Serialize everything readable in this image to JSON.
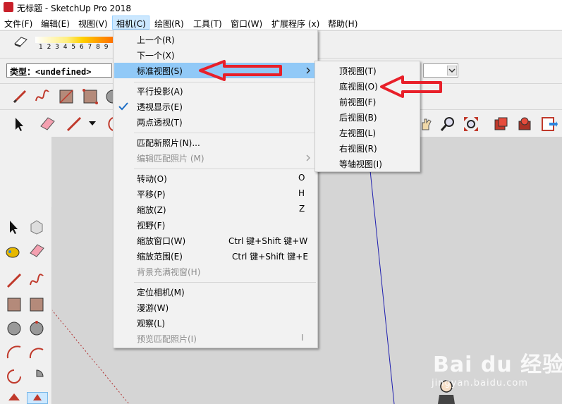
{
  "window": {
    "title": "无标题 - SketchUp Pro 2018"
  },
  "menubar": {
    "items": [
      "文件(F)",
      "编辑(E)",
      "视图(V)",
      "相机(C)",
      "绘图(R)",
      "工具(T)",
      "窗口(W)",
      "扩展程序 (x)",
      "帮助(H)"
    ],
    "active": "相机(C)"
  },
  "toolbar": {
    "shadow_scale": "1 2 3 4 5 6 7 8 9",
    "type_label": "类型：<undefined>"
  },
  "camera_menu": {
    "items": [
      {
        "label": "上一个(R)",
        "shortcut": "",
        "disabled": false
      },
      {
        "label": "下一个(X)",
        "shortcut": "",
        "disabled": false
      },
      {
        "label": "标准视图(S)",
        "shortcut": "",
        "disabled": false,
        "submenu": true,
        "highlighted": true
      },
      {
        "label": "平行投影(A)",
        "shortcut": "",
        "disabled": false
      },
      {
        "label": "透视显示(E)",
        "shortcut": "",
        "disabled": false,
        "checked": true
      },
      {
        "label": "两点透视(T)",
        "shortcut": "",
        "disabled": false
      },
      {
        "label": "匹配新照片(N)...",
        "shortcut": "",
        "disabled": false
      },
      {
        "label": "编辑匹配照片 (M)",
        "shortcut": "",
        "disabled": true,
        "submenu": true
      },
      {
        "label": "转动(O)",
        "shortcut": "O",
        "disabled": false
      },
      {
        "label": "平移(P)",
        "shortcut": "H",
        "disabled": false
      },
      {
        "label": "缩放(Z)",
        "shortcut": "Z",
        "disabled": false
      },
      {
        "label": "视野(F)",
        "shortcut": "",
        "disabled": false
      },
      {
        "label": "缩放窗口(W)",
        "shortcut": "Ctrl 键+Shift 键+W",
        "disabled": false
      },
      {
        "label": "缩放范围(E)",
        "shortcut": "Ctrl 键+Shift 键+E",
        "disabled": false
      },
      {
        "label": "背景充满视窗(H)",
        "shortcut": "",
        "disabled": true
      },
      {
        "label": "定位相机(M)",
        "shortcut": "",
        "disabled": false
      },
      {
        "label": "漫游(W)",
        "shortcut": "",
        "disabled": false
      },
      {
        "label": "观察(L)",
        "shortcut": "",
        "disabled": false
      },
      {
        "label": "预览匹配照片(I)",
        "shortcut": "I",
        "disabled": true
      }
    ]
  },
  "standard_views_submenu": {
    "items": [
      "顶视图(T)",
      "底视图(O)",
      "前视图(F)",
      "后视图(B)",
      "左视图(L)",
      "右视图(R)",
      "等轴视图(I)"
    ]
  },
  "watermark": {
    "logo": "Bai du 经验",
    "url": "jingyan.baidu.com"
  },
  "colors": {
    "menu_highlight": "#91c9f7",
    "menubar_active": "#cce8ff",
    "annotation_arrow": "#e8202a",
    "canvas": "#d5d5d5"
  }
}
